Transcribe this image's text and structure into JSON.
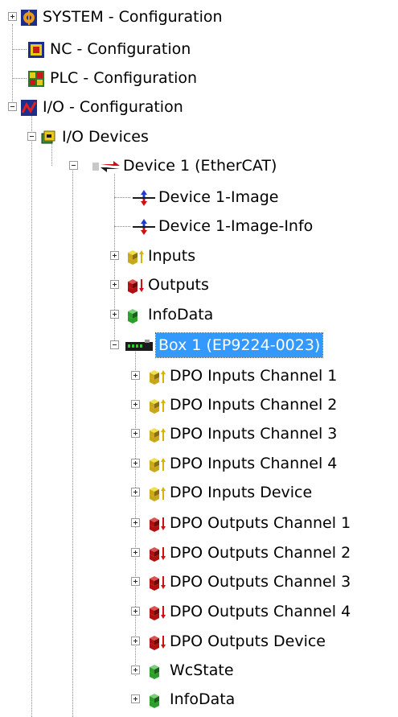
{
  "tree": {
    "items": [
      {
        "label": "SYSTEM - Configuration",
        "icon": "system-config-icon",
        "expander": "plus",
        "level": 0
      },
      {
        "label": "NC - Configuration",
        "icon": "nc-config-icon",
        "expander": "none",
        "level": 0
      },
      {
        "label": "PLC - Configuration",
        "icon": "plc-config-icon",
        "expander": "none",
        "level": 0
      },
      {
        "label": "I/O - Configuration",
        "icon": "io-config-icon",
        "expander": "minus",
        "level": 0
      },
      {
        "label": "I/O Devices",
        "icon": "io-devices-icon",
        "expander": "minus",
        "level": 1
      },
      {
        "label": "Device 1 (EtherCAT)",
        "icon": "ethercat-device-icon",
        "expander": "minus",
        "level": 2
      },
      {
        "label": "Device 1-Image",
        "icon": "image-icon",
        "expander": "none",
        "level": 3
      },
      {
        "label": "Device 1-Image-Info",
        "icon": "image-info-icon",
        "expander": "none",
        "level": 3
      },
      {
        "label": "Inputs",
        "icon": "inputs-icon",
        "expander": "plus",
        "level": 3
      },
      {
        "label": "Outputs",
        "icon": "outputs-icon",
        "expander": "plus",
        "level": 3
      },
      {
        "label": "InfoData",
        "icon": "infodata-icon",
        "expander": "plus",
        "level": 3
      },
      {
        "label": "Box 1 (EP9224-0023)",
        "icon": "box-module-icon",
        "expander": "minus",
        "level": 3,
        "selected": true
      },
      {
        "label": "DPO Inputs Channel 1",
        "icon": "inputs-icon",
        "expander": "plus",
        "level": 4
      },
      {
        "label": "DPO Inputs Channel 2",
        "icon": "inputs-icon",
        "expander": "plus",
        "level": 4
      },
      {
        "label": "DPO Inputs Channel 3",
        "icon": "inputs-icon",
        "expander": "plus",
        "level": 4
      },
      {
        "label": "DPO Inputs Channel 4",
        "icon": "inputs-icon",
        "expander": "plus",
        "level": 4
      },
      {
        "label": "DPO Inputs Device",
        "icon": "inputs-icon",
        "expander": "plus",
        "level": 4
      },
      {
        "label": "DPO Outputs Channel 1",
        "icon": "outputs-icon",
        "expander": "plus",
        "level": 4
      },
      {
        "label": "DPO Outputs Channel 2",
        "icon": "outputs-icon",
        "expander": "plus",
        "level": 4
      },
      {
        "label": "DPO Outputs Channel 3",
        "icon": "outputs-icon",
        "expander": "plus",
        "level": 4
      },
      {
        "label": "DPO Outputs Channel 4",
        "icon": "outputs-icon",
        "expander": "plus",
        "level": 4
      },
      {
        "label": "DPO Outputs Device",
        "icon": "outputs-icon",
        "expander": "plus",
        "level": 4
      },
      {
        "label": "WcState",
        "icon": "wcstate-icon",
        "expander": "plus",
        "level": 4
      },
      {
        "label": "InfoData",
        "icon": "infodata-icon",
        "expander": "plus",
        "level": 4
      }
    ]
  },
  "colors": {
    "selection": "#3399ff",
    "selection_text": "#ffffff",
    "tree_lines": "#8a8a8a",
    "inputs_arrow": "#d8b400",
    "outputs_arrow": "#d01010",
    "infodata_green": "#2aa02a"
  }
}
